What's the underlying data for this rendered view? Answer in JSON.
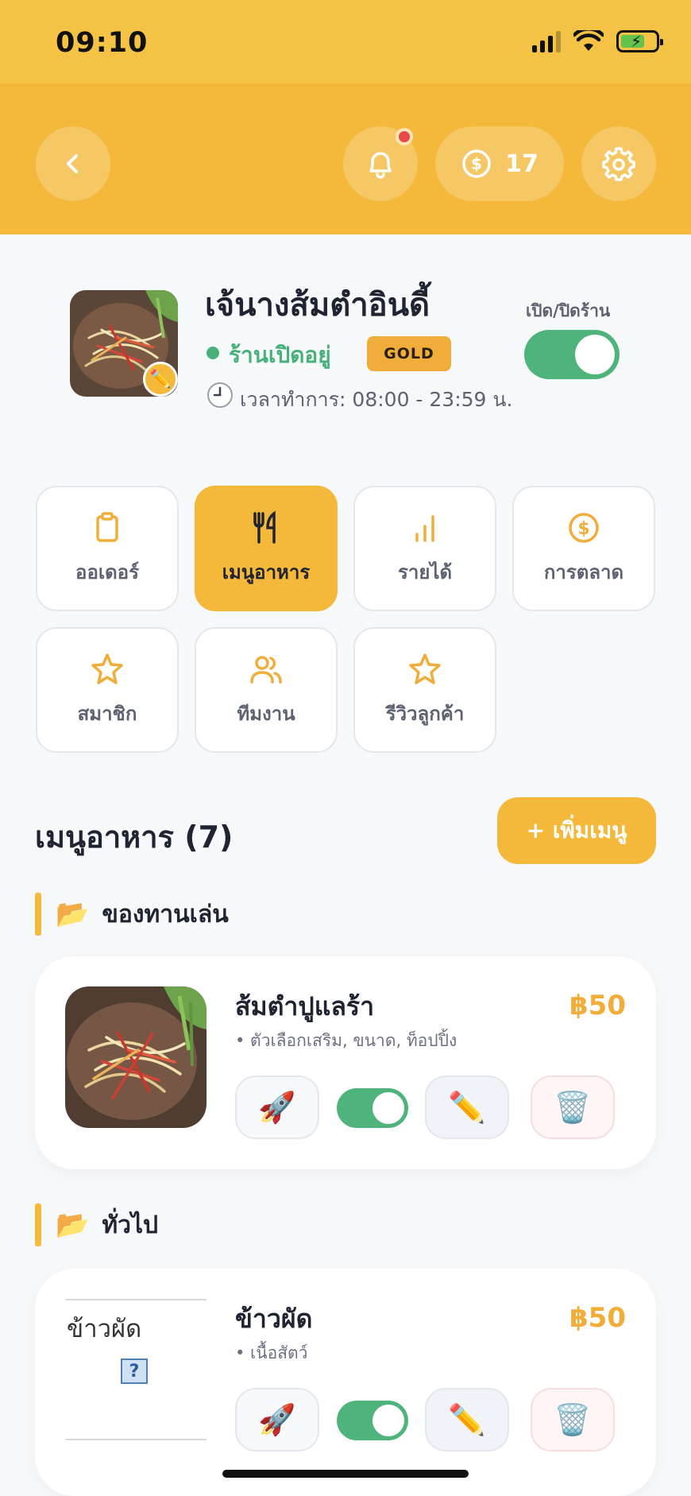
{
  "status_bar": {
    "time": "09:10"
  },
  "header": {
    "coin_count": "17"
  },
  "shop": {
    "name": "เจ้นางส้มตำอินดี้",
    "status": "ร้านเปิดอยู่",
    "tier": "GOLD",
    "hours": "เวลาทำการ: 08:00 - 23:59 น.",
    "toggle_label": "เปิด/ปิดร้าน",
    "is_open": true
  },
  "nav": [
    {
      "label": "ออเดอร์",
      "icon": "clipboard-icon"
    },
    {
      "label": "เมนูอาหาร",
      "icon": "fork-knife-icon",
      "active": true
    },
    {
      "label": "รายได้",
      "icon": "bar-chart-icon"
    },
    {
      "label": "การตลาด",
      "icon": "dollar-coin-icon"
    },
    {
      "label": "สมาชิก",
      "icon": "star-icon"
    },
    {
      "label": "ทีมงาน",
      "icon": "users-icon"
    },
    {
      "label": "รีวิวลูกค้า",
      "icon": "star-icon"
    }
  ],
  "menu": {
    "title": "เมนูอาหาร (7)",
    "add_button": "+ เพิ่มเมนู",
    "categories": [
      {
        "name": "ของทานเล่น",
        "items": [
          {
            "name": "ส้มตำปูแลร้า",
            "options": "• ตัวเลือกเสริม, ขนาด, ท็อปปิ้ง",
            "price": "฿50",
            "enabled": true
          }
        ]
      },
      {
        "name": "ทั่วไป",
        "items": [
          {
            "name": "ข้าวผัด",
            "options": "• เนื้อสัตว์",
            "price": "฿50",
            "enabled": true,
            "image_alt": "ข้าวผัด"
          }
        ]
      }
    ]
  },
  "colors": {
    "primary": "#f4b83a",
    "status_bar": "#f4c244",
    "success": "#4fb47c",
    "price": "#f0ad3a"
  }
}
